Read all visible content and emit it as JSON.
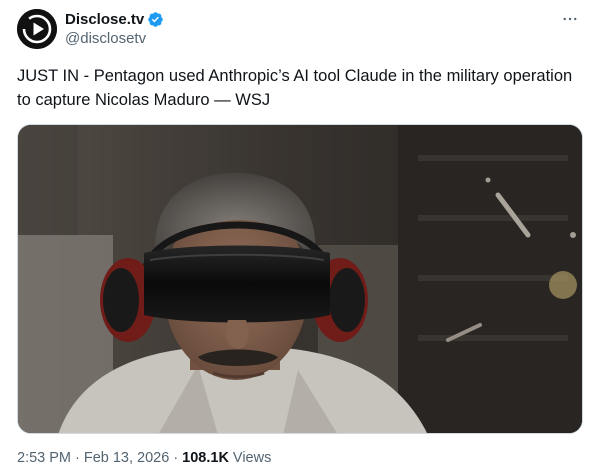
{
  "author": {
    "display_name": "Disclose.tv",
    "handle": "@disclosetv",
    "verified": true,
    "avatar_icon": "disclose-play-logo-icon"
  },
  "tweet": {
    "text": "JUST IN - Pentagon used Anthropic’s AI tool Claude in the military operation to capture Nicolas Maduro — WSJ"
  },
  "media": {
    "icon": "photo-man-with-blackout-goggles-and-ear-defenders"
  },
  "meta": {
    "time": "2:53 PM",
    "date": "Feb 13, 2026",
    "separator": "·",
    "views_count": "108.1K",
    "views_label": "Views"
  },
  "colors": {
    "primary_text": "#0f1419",
    "secondary_text": "#536471",
    "verified_blue": "#1d9bf0",
    "border": "#cfd9de"
  }
}
